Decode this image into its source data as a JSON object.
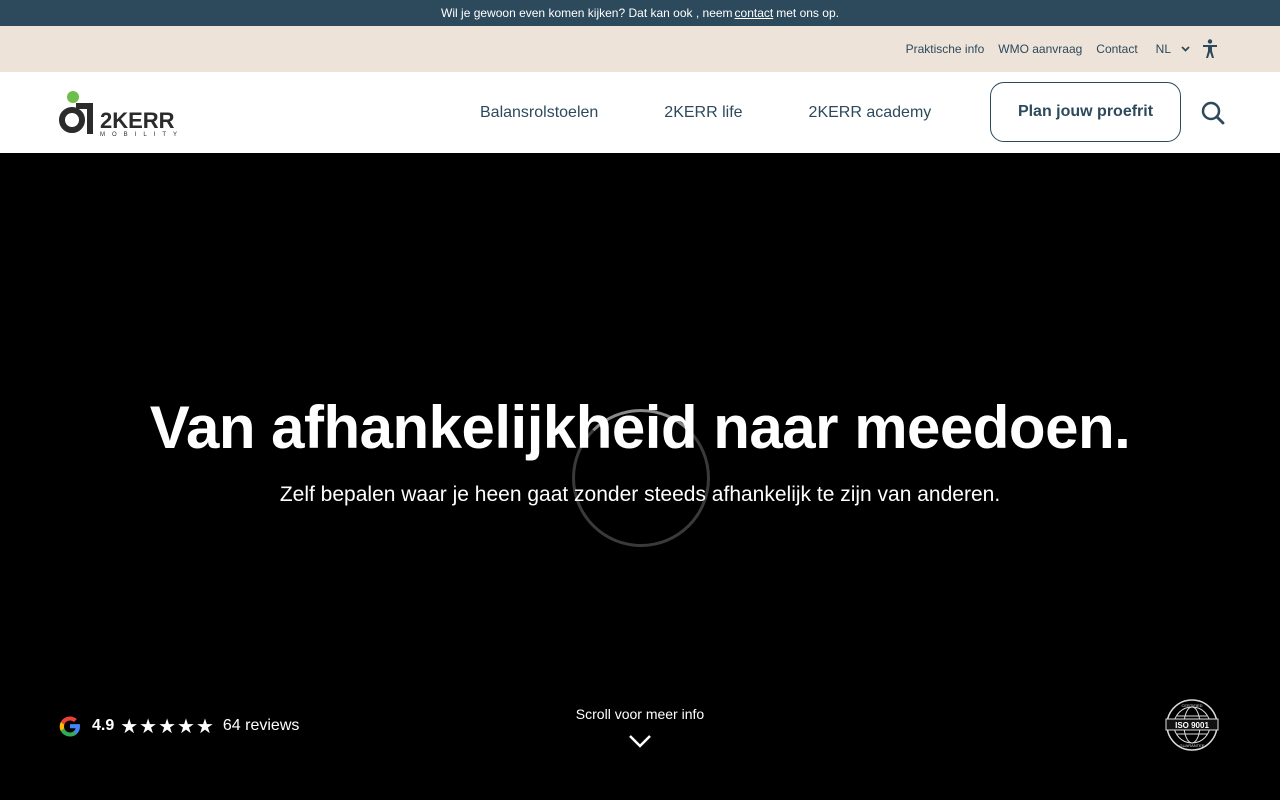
{
  "announcement": {
    "text_before": "Wil je gewoon even komen kijken? Dat kan ook , neem",
    "link": "contact",
    "text_after": "met ons op."
  },
  "utility_nav": {
    "links": [
      "Praktische info",
      "WMO aanvraag",
      "Contact"
    ],
    "language": "NL",
    "icons": {
      "language_chevron": "chevron-down-icon",
      "accessibility": "accessibility-icon"
    }
  },
  "brand": {
    "name": "2KERR",
    "tagline": "MOBILITY",
    "accent": "#6cbf4a",
    "dark": "#2b2b2b"
  },
  "main_nav": {
    "links": [
      "Balansrolstoelen",
      "2KERR life",
      "2KERR academy"
    ],
    "cta": "Plan jouw proefrit",
    "search_icon": "search-icon"
  },
  "hero": {
    "title": "Van afhankelijkheid naar meedoen.",
    "subtitle": "Zelf bepalen waar je heen gaat zonder steeds afhankelijk te zijn van anderen.",
    "state": "loading"
  },
  "rating": {
    "score": "4.9",
    "stars": 5,
    "reviews": "64 reviews",
    "icon": "google-icon"
  },
  "scroll_hint": {
    "label": "Scroll voor meer info",
    "icon": "chevron-down-icon"
  },
  "badge": {
    "main": "ISO 9001",
    "top": "CERTIFIED",
    "bottom": "GUARANTEE"
  },
  "colors": {
    "primary": "#2c4a5c",
    "beige": "#ede3d8",
    "hero_bg": "#000000"
  }
}
